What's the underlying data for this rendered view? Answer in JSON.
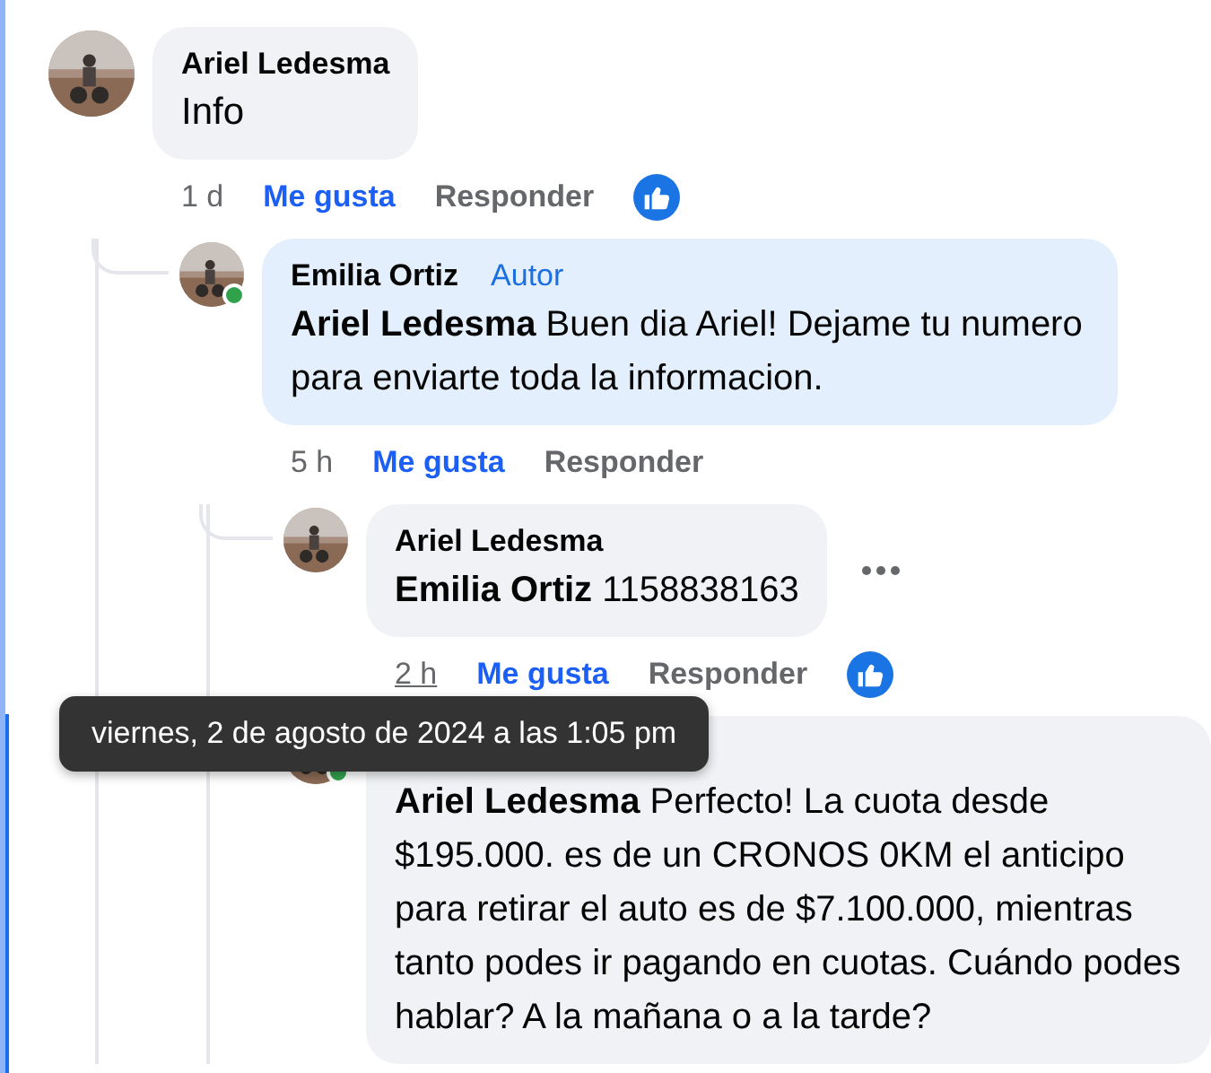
{
  "comments": [
    {
      "author": "Ariel Ledesma",
      "text": "Info",
      "highlighted": false,
      "actions": {
        "time": "1 d",
        "time_hovered": false,
        "like": "Me gusta",
        "reply": "Responder",
        "liked_reaction": true
      },
      "children": [
        {
          "author": "Emilia Ortiz",
          "badge": "Autor",
          "text": "**Ariel Ledesma** Buen dia Ariel! Dejame tu numero para enviarte toda la informacion.",
          "online": true,
          "highlighted": true,
          "actions": {
            "time": "5 h",
            "time_hovered": false,
            "like": "Me gusta",
            "reply": "Responder"
          },
          "children": [
            {
              "author": "Ariel Ledesma",
              "text": "**Emilia Ortiz** 1158838163",
              "highlighted": false,
              "more_menu": true,
              "actions": {
                "time": "2 h",
                "time_hovered": true,
                "like": "Me gusta",
                "reply": "Responder",
                "liked_reaction": true
              }
            },
            {
              "text": "**Ariel Ledesma** Perfecto! La cuota desde $195.000. es de un CRONOS 0KM el anticipo para retirar el auto es de $7.100.000, mientras tanto podes ir pagando en cuotas. Cuándo podes hablar? A la mañana o a la tarde?",
              "online": true,
              "highlighted": false
            }
          ]
        }
      ]
    }
  ],
  "tooltip": {
    "text": "viernes, 2 de agosto de 2024 a las 1:05 pm"
  }
}
